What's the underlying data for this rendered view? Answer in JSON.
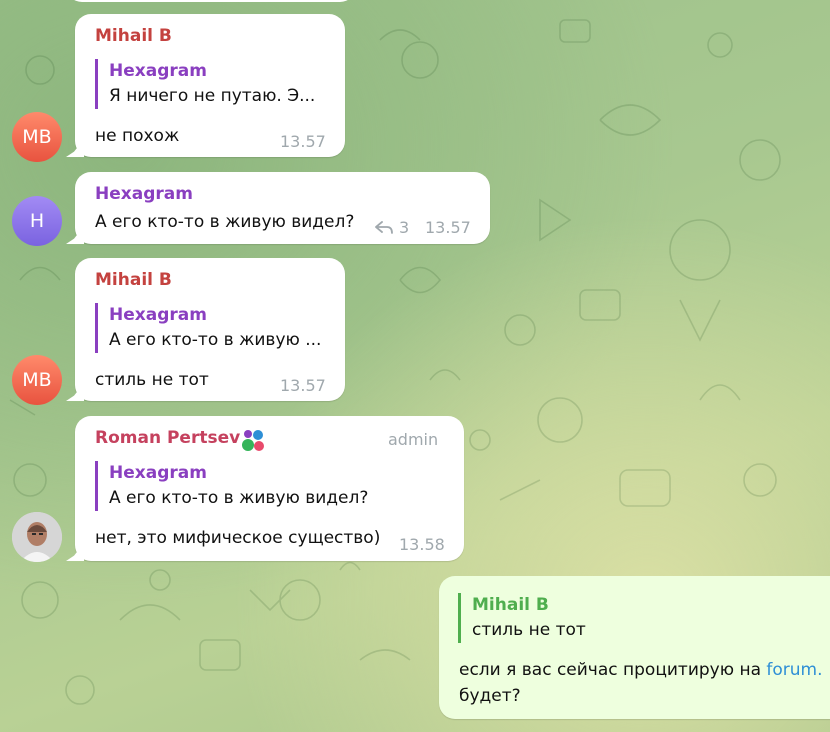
{
  "messages": [
    {
      "sender": "Mihail B",
      "avatar_initials": "MB",
      "quote": {
        "name": "Hexagram",
        "text": "Я ничего не путаю. Э..."
      },
      "text": "не похож",
      "time": "13.57"
    },
    {
      "sender": "Hexagram",
      "avatar_initials": "H",
      "text": "А его кто-то в живую видел?",
      "replies_count": "3",
      "time": "13.57"
    },
    {
      "sender": "Mihail B",
      "avatar_initials": "MB",
      "quote": {
        "name": "Hexagram",
        "text": "А его кто-то в живую ..."
      },
      "text": "стиль не тот",
      "time": "13.57"
    },
    {
      "sender": "Roman Pertsev",
      "badge": "admin",
      "quote": {
        "name": "Hexagram",
        "text": "А его кто-то в живую видел?"
      },
      "text": "нет, это мифическое существо)",
      "time": "13.58"
    },
    {
      "outgoing": true,
      "quote": {
        "name": "Mihail B",
        "text": "стиль не тот"
      },
      "text_line1_prefix": "если я вас сейчас процитирую на ",
      "text_line1_link": "forum.",
      "text_line2": "будет?"
    }
  ],
  "colors": {
    "mihail": "#c4423f",
    "hexagram": "#8a3fc0",
    "roman": "#c5415e",
    "outgoing_name": "#4fae4e",
    "link": "#2e8fd6",
    "time": "#a0a8ad"
  },
  "icons": [
    "reply-arrow-icon",
    "emoji-status-icon"
  ]
}
